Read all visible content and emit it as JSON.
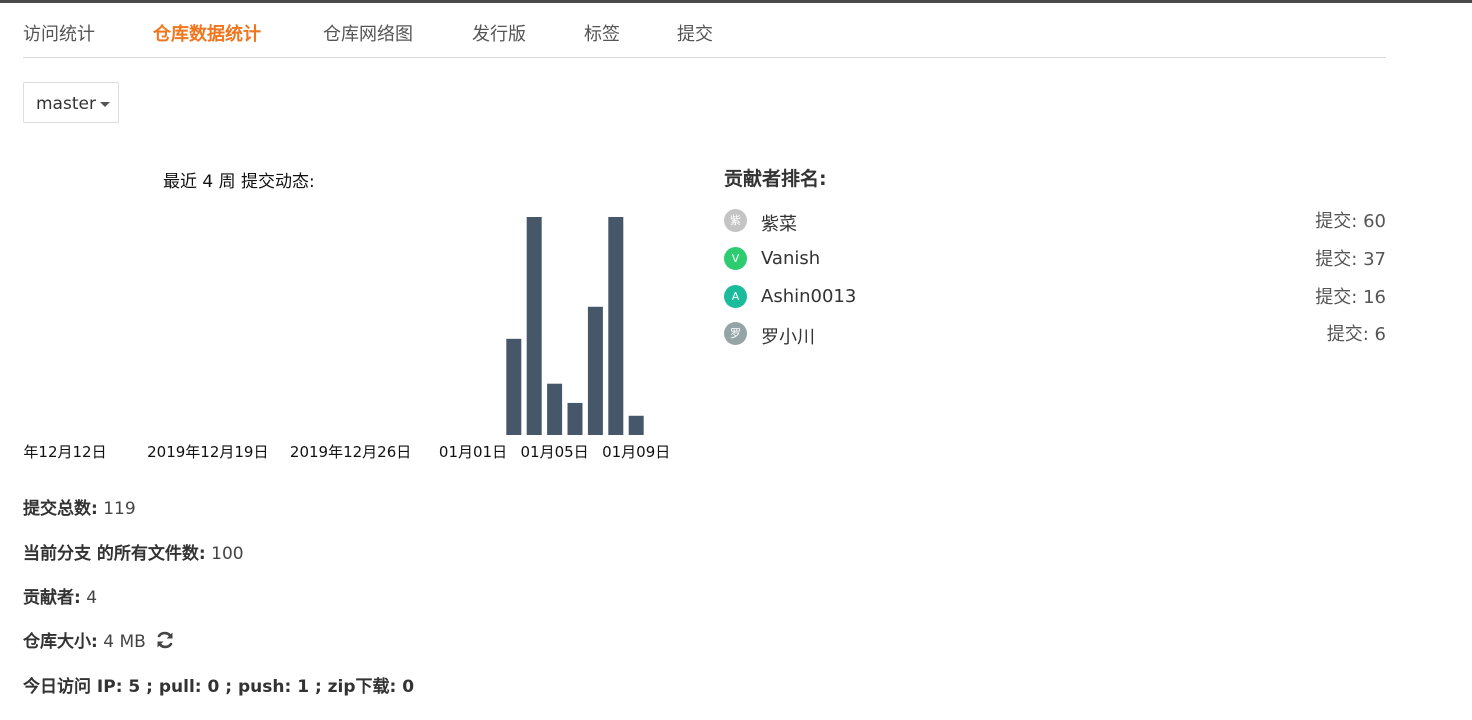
{
  "tabs": [
    {
      "label": "访问统计",
      "active": false
    },
    {
      "label": "仓库数据统计",
      "active": true
    },
    {
      "label": "仓库网络图",
      "active": false
    },
    {
      "label": "发行版",
      "active": false
    },
    {
      "label": "标签",
      "active": false
    },
    {
      "label": "提交",
      "active": false
    }
  ],
  "branch": {
    "label": "master",
    "icon": "caret-down-icon"
  },
  "activity": {
    "title": "最近 4 周 提交动态:"
  },
  "chart_data": {
    "type": "bar",
    "title": "最近 4 周 提交动态:",
    "x_tick_labels": [
      "年12月12日",
      "2019年12月19日",
      "2019年12月26日",
      "01月01日",
      "01月05日",
      "01月09日"
    ],
    "bars": [
      {
        "date": "2020-01-03",
        "value": 15
      },
      {
        "date": "2020-01-04",
        "value": 34
      },
      {
        "date": "2020-01-05",
        "value": 8
      },
      {
        "date": "2020-01-06",
        "value": 5
      },
      {
        "date": "2020-01-07",
        "value": 20
      },
      {
        "date": "2020-01-08",
        "value": 34
      },
      {
        "date": "2020-01-09",
        "value": 3
      }
    ],
    "ylim": [
      0,
      34
    ],
    "bar_color": "#47576a",
    "grid": false
  },
  "contributors": {
    "title": "贡献者排名:",
    "items": [
      {
        "avatar": "紫",
        "name": "紫菜",
        "commits": "提交: 60",
        "color": "#c4c4c4"
      },
      {
        "avatar": "V",
        "name": "Vanish",
        "commits": "提交: 37",
        "color": "#2ecc71"
      },
      {
        "avatar": "A",
        "name": "Ashin0013",
        "commits": "提交: 16",
        "color": "#1abc9c"
      },
      {
        "avatar": "罗",
        "name": "罗小川",
        "commits": "提交: 6",
        "color": "#95a5a6"
      }
    ]
  },
  "stats": {
    "total_commits": {
      "label": "提交总数:",
      "value": "119"
    },
    "file_count": {
      "label": "当前分支 的所有文件数:",
      "value": "100"
    },
    "contributors": {
      "label": "贡献者:",
      "value": "4"
    },
    "repo_size": {
      "label": "仓库大小:",
      "value": "4 MB",
      "icon": "refresh-icon"
    },
    "today_visits": {
      "label": "今日访问 IP: 5 ; pull: 0 ; push: 1 ; zip下载: 0"
    }
  }
}
